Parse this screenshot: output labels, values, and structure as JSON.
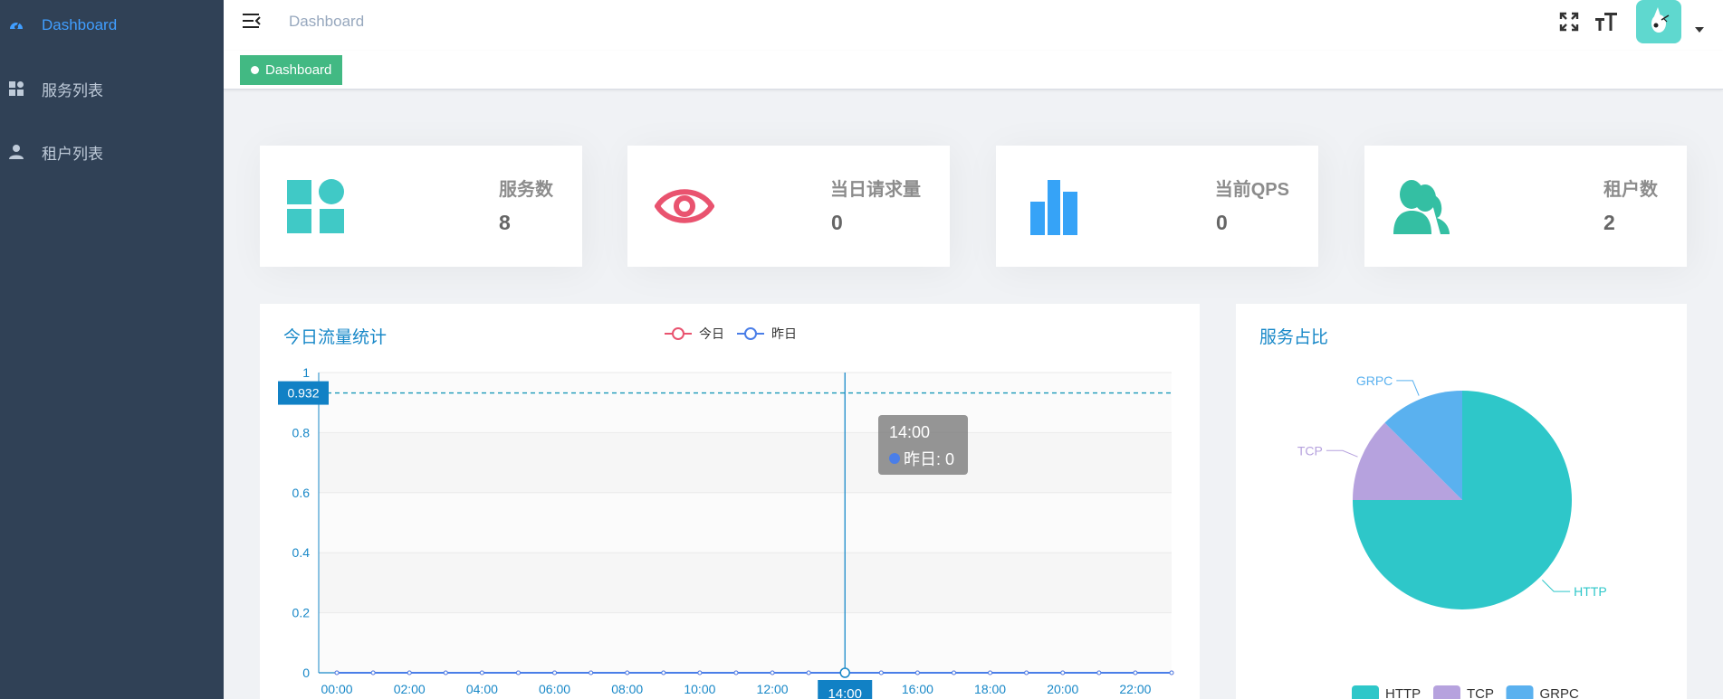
{
  "sidebar": {
    "items": [
      {
        "label": "Dashboard",
        "icon": "dashboard-icon",
        "active": true
      },
      {
        "label": "服务列表",
        "icon": "grid-icon",
        "active": false
      },
      {
        "label": "租户列表",
        "icon": "user-icon",
        "active": false
      }
    ]
  },
  "header": {
    "breadcrumb": "Dashboard"
  },
  "tags": {
    "active": "Dashboard"
  },
  "stats": [
    {
      "title": "服务数",
      "value": "8",
      "icon": "apps-icon",
      "color": "#40c9c6"
    },
    {
      "title": "当日请求量",
      "value": "0",
      "icon": "eye-icon",
      "color": "#e9536f"
    },
    {
      "title": "当前QPS",
      "value": "0",
      "icon": "bar-chart-icon",
      "color": "#36a3f7"
    },
    {
      "title": "租户数",
      "value": "2",
      "icon": "people-icon",
      "color": "#34bfa3"
    }
  ],
  "flow_panel": {
    "title": "今日流量统计",
    "legend": [
      "今日",
      "昨日"
    ],
    "tooltip_time": "14:00",
    "tooltip_line": "昨日: 0",
    "marker_value": "0.932",
    "axis_pointer_label": "14:00"
  },
  "pie_panel": {
    "title": "服务占比"
  },
  "chart_data": [
    {
      "type": "line",
      "title": "今日流量统计",
      "x": [
        "00:00",
        "01:00",
        "02:00",
        "03:00",
        "04:00",
        "05:00",
        "06:00",
        "07:00",
        "08:00",
        "09:00",
        "10:00",
        "11:00",
        "12:00",
        "13:00",
        "14:00",
        "15:00",
        "16:00",
        "17:00",
        "18:00",
        "19:00",
        "20:00",
        "21:00",
        "22:00",
        "23:00"
      ],
      "tick_labels": [
        "00:00",
        "02:00",
        "04:00",
        "06:00",
        "08:00",
        "10:00",
        "12:00",
        "14:00",
        "16:00",
        "18:00",
        "20:00",
        "22:00"
      ],
      "series": [
        {
          "name": "今日",
          "color": "#e9536f",
          "values": [
            0,
            0,
            0,
            0,
            0,
            0,
            0,
            0,
            0,
            0,
            0,
            0,
            0,
            0,
            0,
            0,
            0,
            0,
            0,
            0,
            0,
            0,
            0,
            0
          ]
        },
        {
          "name": "昨日",
          "color": "#4a7ee8",
          "values": [
            0,
            0,
            0,
            0,
            0,
            0,
            0,
            0,
            0,
            0,
            0,
            0,
            0,
            0,
            0,
            0,
            0,
            0,
            0,
            0,
            0,
            0,
            0,
            0
          ]
        }
      ],
      "ylim": [
        0,
        1
      ],
      "yticks": [
        "0",
        "0.2",
        "0.4",
        "0.6",
        "0.8",
        "1"
      ],
      "legend_position": "top",
      "grid": true
    },
    {
      "type": "pie",
      "title": "服务占比",
      "labels": [
        "HTTP",
        "TCP",
        "GRPC"
      ],
      "values": [
        6,
        1,
        1
      ],
      "colors": [
        "#2ec7c9",
        "#b6a2de",
        "#5ab1ef"
      ],
      "legend_position": "bottom"
    }
  ]
}
